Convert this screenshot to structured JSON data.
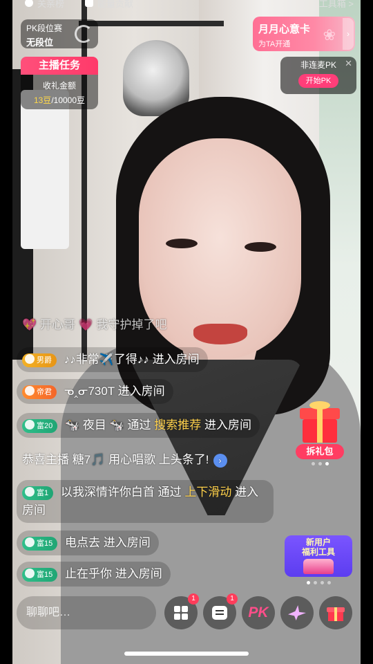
{
  "top": {
    "tab1": "关亲榜",
    "tab2": "能量贡献",
    "toolbox": "工具箱 >"
  },
  "pk_rank": {
    "title": "PK段位赛",
    "value": "无段位"
  },
  "task": {
    "label": "主播任务",
    "desc": "收礼金额",
    "current": "13豆",
    "target": "/10000豆"
  },
  "monthly": {
    "title": "月月心意卡",
    "subtitle": "为TA开通"
  },
  "pk_box": {
    "title": "非连麦PK",
    "button": "开始PK"
  },
  "chat": {
    "messages": [
      {
        "user": "💖 开心哥 💗",
        "text": "我守护掉了吧"
      },
      {
        "badge": "男爵",
        "user": "♪♪非常✈️了得♪♪",
        "text": "进入房间"
      },
      {
        "badge": "帝君",
        "user": "ᓀ‸ᓂ730T",
        "text": "进入房间"
      },
      {
        "badge": "富20",
        "user": "🐄 夜目 🐄",
        "via": "通过",
        "source": "搜索推荐",
        "text": "进入房间"
      },
      {
        "announce": "恭喜主播 糖7🎵 用心唱歌 上头条了!"
      },
      {
        "badge": "富1",
        "user": "以我深情许你白首",
        "via": "通过",
        "source": "上下滑动",
        "text": "进入房间"
      },
      {
        "badge": "富15",
        "user": "电点去",
        "text": "进入房间"
      },
      {
        "badge": "富15",
        "user": "止在乎你",
        "text": "进入房间"
      }
    ]
  },
  "gift_pack": {
    "label": "拆礼包"
  },
  "newbie": {
    "line1": "新用户",
    "line2": "福利工具"
  },
  "bottom": {
    "placeholder": "聊聊吧…",
    "apps_badge": "1",
    "msg_badge": "1",
    "pk_label": "PK"
  },
  "colors": {
    "accent_pink": "#ff3e79",
    "highlight_yellow": "#ffd24d"
  },
  "icons": [
    "apps-icon",
    "message-icon",
    "pk-icon",
    "paper-crane-icon",
    "gift-icon",
    "close-icon"
  ]
}
